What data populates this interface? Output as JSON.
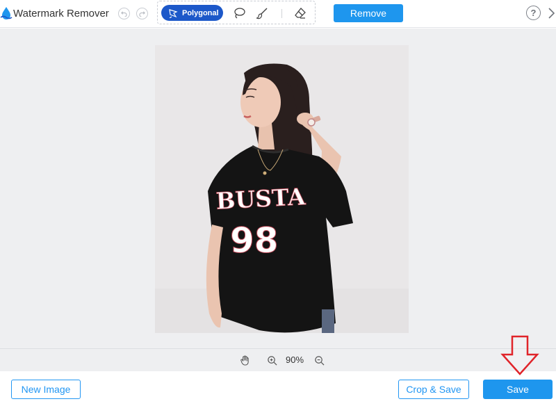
{
  "header": {
    "app_title": "Watermark Remover",
    "logo_icon": "water-drop-icon",
    "undo_icon": "undo-icon",
    "redo_icon": "redo-icon",
    "tools": {
      "polygonal_label": "Polygonal",
      "polygonal_icon": "polygon-lasso-icon",
      "lasso_icon": "lasso-icon",
      "brush_icon": "brush-icon",
      "eraser_icon": "eraser-icon"
    },
    "remove_label": "Remove",
    "help_label": "?",
    "help_icon": "help-icon",
    "expand_icon": "chevron-right-icon"
  },
  "canvas": {
    "image_subject": "woman-in-black-tshirt-photo",
    "shirt_text_top": "BUSTA",
    "shirt_text_number": "98"
  },
  "zoom": {
    "pan_icon": "hand-icon",
    "zoom_in_icon": "zoom-in-icon",
    "zoom_out_icon": "zoom-out-icon",
    "level": "90%"
  },
  "footer": {
    "new_image_label": "New Image",
    "crop_save_label": "Crop & Save",
    "save_label": "Save",
    "annotation_icon": "down-arrow-annotation-icon"
  },
  "colors": {
    "primary": "#1e96ee",
    "tool_active": "#1c58c9",
    "canvas_bg": "#eeeff1",
    "annotation": "#e0242a"
  }
}
